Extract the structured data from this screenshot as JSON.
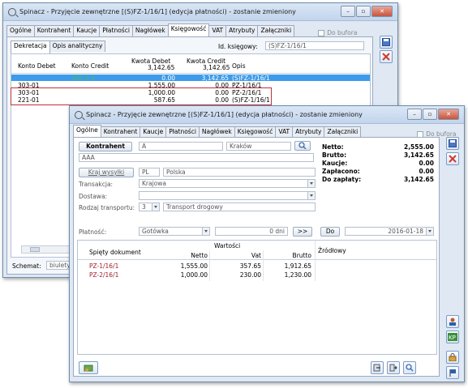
{
  "back": {
    "title": "Spinacz - Przyjęcie zewnętrzne [(S)FZ-1/16/1] (edycja płatności) - zostanie zmieniony",
    "tabs": [
      "Ogólne",
      "Kontrahent",
      "Kaucje",
      "Płatności",
      "Nagłówek",
      "Księgowość",
      "VAT",
      "Atrybuty",
      "Załączniki"
    ],
    "active_tab": "Księgowość",
    "do_bufora": "Do bufora",
    "subtabs": [
      "Dekretacja",
      "Opis analityczny"
    ],
    "id_label": "Id. księgowy:",
    "id_value": "(S)FZ-1/16/1",
    "columns": [
      "Konto Debet",
      "Konto Credit",
      "Kwota Debet",
      "Kwota Credit",
      "Opis"
    ],
    "totals": {
      "debet": "3,142.65",
      "credit": "3,142.65"
    },
    "rows": [
      {
        "debet_acc": "",
        "credit_acc": "202-2-1",
        "kd": "0.00",
        "kc": "3,142.65",
        "opis": "(S)FZ-1/16/1",
        "selected": true
      },
      {
        "debet_acc": "303-01",
        "credit_acc": "",
        "kd": "1,555.00",
        "kc": "0.00",
        "opis": "PZ-1/16/1",
        "selected": false
      },
      {
        "debet_acc": "303-01",
        "credit_acc": "",
        "kd": "1,000.00",
        "kc": "0.00",
        "opis": "PZ-2/16/1",
        "selected": false
      },
      {
        "debet_acc": "221-01",
        "credit_acc": "",
        "kd": "587.65",
        "kc": "0.00",
        "opis": "(S)FZ-1/16/1",
        "selected": false
      }
    ],
    "schemat_label": "Schemat:",
    "schemat_value": "biulety"
  },
  "front": {
    "title": "Spinacz - Przyjęcie zewnętrzne [(S)FZ-1/16/1] (edycja płatności) - zostanie zmieniony",
    "tabs": [
      "Ogólne",
      "Kontrahent",
      "Kaucje",
      "Płatności",
      "Nagłówek",
      "Księgowość",
      "VAT",
      "Atrybuty",
      "Załączniki"
    ],
    "active_tab": "Ogólne",
    "do_bufora": "Do bufora",
    "kontrahent_btn": "Kontrahent",
    "kontrahent_code": "A",
    "kontrahent_city": "Kraków",
    "kontrahent_name": "AAA",
    "kraj_btn": "Kraj wysyłki",
    "kraj_code": "PL",
    "kraj_name": "Polska",
    "transakcja_label": "Transakcja:",
    "transakcja_value": "Krajowa",
    "dostawa_label": "Dostawa:",
    "dostawa_value": "",
    "rodzaj_label": "Rodzaj transportu:",
    "rodzaj_code": "3",
    "rodzaj_value": "Transport drogowy",
    "platnosc_label": "Płatność:",
    "platnosc_value": "Gotówka",
    "dni_value": "0 dni",
    "arrows": ">>",
    "do_btn": "Do",
    "date_value": "2016-01-18",
    "summary": [
      {
        "label": "Netto:",
        "value": "2,555.00"
      },
      {
        "label": "Brutto:",
        "value": "3,142.65"
      },
      {
        "label": "Kaucje:",
        "value": "0.00"
      },
      {
        "label": "Zapłacono:",
        "value": "0.00"
      },
      {
        "label": "Do zapłaty:",
        "value": "3,142.65"
      }
    ],
    "table": {
      "col_doc": "Spięty dokument",
      "group": "Wartości",
      "col_netto": "Netto",
      "col_vat": "Vat",
      "col_brutto": "Brutto",
      "col_zrodlowy": "Źródłowy",
      "rows": [
        {
          "doc": "PZ-1/16/1",
          "netto": "1,555.00",
          "vat": "357.65",
          "brutto": "1,912.65"
        },
        {
          "doc": "PZ-2/16/1",
          "netto": "1,000.00",
          "vat": "230.00",
          "brutto": "1,230.00"
        }
      ]
    }
  }
}
